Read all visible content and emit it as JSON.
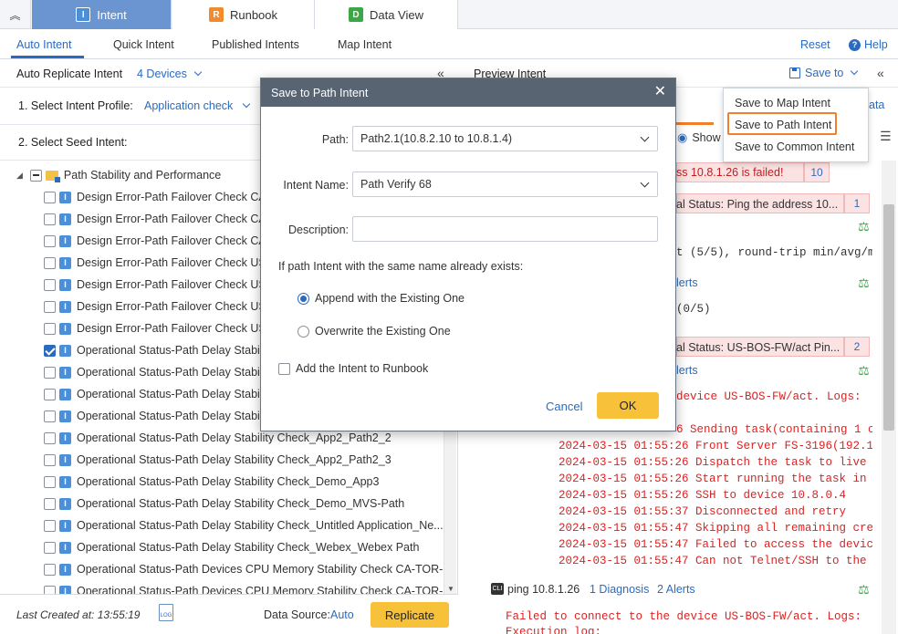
{
  "top_tabs": [
    {
      "label": "Intent",
      "badge": "I",
      "color": "#4a8fd8"
    },
    {
      "label": "Runbook",
      "badge": "R",
      "color": "#f08c2e"
    },
    {
      "label": "Data View",
      "badge": "D",
      "color": "#3aa845"
    }
  ],
  "subnav": {
    "items": [
      "Auto Intent",
      "Quick Intent",
      "Published Intents",
      "Map Intent"
    ],
    "reset": "Reset",
    "help": "Help"
  },
  "left": {
    "header_title": "Auto Replicate Intent",
    "devices": "4 Devices",
    "step1_label": "1. Select Intent Profile:",
    "step1_value": "Application check",
    "step2_label": "2. Select Seed Intent:",
    "tree_root": "Path Stability and Performance",
    "items": [
      {
        "label": "Design Error-Path Failover Check CA",
        "checked": false
      },
      {
        "label": "Design Error-Path Failover Check CA",
        "checked": false
      },
      {
        "label": "Design Error-Path Failover Check CA",
        "checked": false
      },
      {
        "label": "Design Error-Path Failover Check US",
        "checked": false
      },
      {
        "label": "Design Error-Path Failover Check US",
        "checked": false
      },
      {
        "label": "Design Error-Path Failover Check US",
        "checked": false
      },
      {
        "label": "Design Error-Path Failover Check US",
        "checked": false
      },
      {
        "label": "Operational Status-Path Delay Stabil",
        "checked": true
      },
      {
        "label": "Operational Status-Path Delay Stabil",
        "checked": false
      },
      {
        "label": "Operational Status-Path Delay Stabil",
        "checked": false
      },
      {
        "label": "Operational Status-Path Delay Stabil",
        "checked": false
      },
      {
        "label": "Operational Status-Path Delay Stability Check_App2_Path2_2",
        "checked": false
      },
      {
        "label": "Operational Status-Path Delay Stability Check_App2_Path2_3",
        "checked": false
      },
      {
        "label": "Operational Status-Path Delay Stability Check_Demo_App3",
        "checked": false
      },
      {
        "label": "Operational Status-Path Delay Stability Check_Demo_MVS-Path",
        "checked": false
      },
      {
        "label": "Operational Status-Path Delay Stability Check_Untitled Application_Ne...",
        "checked": false
      },
      {
        "label": "Operational Status-Path Delay Stability Check_Webex_Webex Path",
        "checked": false
      },
      {
        "label": "Operational Status-Path Devices CPU Memory Stability Check CA-TOR-...",
        "checked": false
      },
      {
        "label": "Operational Status-Path Devices CPU Memory Stability Check CA-TOR-...",
        "checked": false
      }
    ],
    "last_created": "Last Created at: 13:55:19",
    "log_icon": "LOG",
    "data_source_label": "Data Source:",
    "data_source_value": "Auto",
    "replicate": "Replicate"
  },
  "right": {
    "header_title": "Preview Intent",
    "save_to": "Save to",
    "data_link": "ata",
    "show_label": "Show",
    "rows": [
      {
        "text": "ss 10.8.1.26 is failed!",
        "count": "10"
      },
      {
        "text": "al Status: Ping the address 10...",
        "count": "1"
      },
      {
        "text": "al Status: US-BOS-FW/act Pin...",
        "count": "2"
      }
    ],
    "mono_dark_1": "t (5/5), round-trip min/avg/m...",
    "alerts_1": "lerts",
    "mono_dark_2": "(0/5)",
    "alerts_2": "lerts",
    "device_log": "device US-BOS-FW/act. Logs:",
    "log_lines": [
      "6 Sending task(containing 1 c...",
      "2024-03-15 01:55:26 Front Server FS-3196(192.16...",
      "2024-03-15 01:55:26 Dispatch the task to live t...",
      "2024-03-15 01:55:26 Start running the task in l...",
      "2024-03-15 01:55:26 SSH to device 10.8.0.4",
      "2024-03-15 01:55:37 Disconnected and retry",
      "2024-03-15 01:55:47 Skipping all remaining cred...",
      "2024-03-15 01:55:47 Failed to access the device...",
      "2024-03-15 01:55:47 Can not Telnet/SSH to the d..."
    ],
    "ping_badge": "CLI",
    "ping_text": "ping 10.8.1.26",
    "ping_diag": "1 Diagnosis",
    "ping_alerts": "2 Alerts",
    "fail_text": "Failed to connect to the device US-BOS-FW/act. Logs:",
    "exec_text": "Execution log:"
  },
  "menu": {
    "items": [
      "Save to Map Intent",
      "Save to Path Intent",
      "Save to Common Intent"
    ],
    "highlighted": "Save to Path Intent"
  },
  "dialog": {
    "title": "Save to Path Intent",
    "path_label": "Path:",
    "path_value": "Path2.1(10.8.2.10 to 10.8.1.4)",
    "name_label": "Intent Name:",
    "name_value": "Path Verify 68",
    "desc_label": "Description:",
    "desc_value": "",
    "exists_question": "If path Intent with the same name already exists:",
    "opt_append": "Append with the Existing One",
    "opt_overwrite": "Overwrite the Existing One",
    "add_runbook": "Add the Intent to Runbook",
    "cancel": "Cancel",
    "ok": "OK"
  }
}
